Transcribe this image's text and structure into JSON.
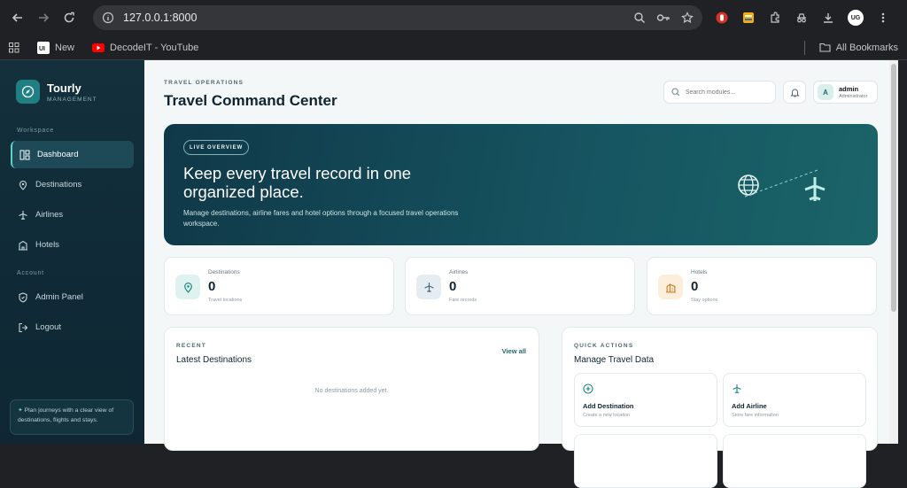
{
  "browser": {
    "url": "127.0.0.1:8000",
    "profile_initials": "UG",
    "bookmarks": [
      {
        "label": "New"
      },
      {
        "label": "DecodeIT - YouTube"
      }
    ],
    "all_bookmarks": "All Bookmarks"
  },
  "sidebar": {
    "brand_name": "Tourly",
    "brand_sub": "MANAGEMENT",
    "workspace_label": "Workspace",
    "account_label": "Account",
    "items": [
      {
        "label": "Dashboard"
      },
      {
        "label": "Destinations"
      },
      {
        "label": "Airlines"
      },
      {
        "label": "Hotels"
      }
    ],
    "account_items": [
      {
        "label": "Admin Panel"
      },
      {
        "label": "Logout"
      }
    ],
    "note": "Plan journeys with a clear view of destinations, flights and stays."
  },
  "header": {
    "eyebrow": "TRAVEL OPERATIONS",
    "title": "Travel Command Center",
    "search_placeholder": "Search modules...",
    "user_initial": "A",
    "user_name": "admin",
    "user_role": "Administrator"
  },
  "hero": {
    "badge": "LIVE OVERVIEW",
    "title": "Keep every travel record in one organized place.",
    "description": "Manage destinations, airline fares and hotel options through a focused travel operations workspace."
  },
  "stats": [
    {
      "label": "Destinations",
      "value": "0",
      "sub": "Travel locations",
      "color": "#1f8a7e"
    },
    {
      "label": "Airlines",
      "value": "0",
      "sub": "Fare records",
      "color": "#4a6b86"
    },
    {
      "label": "Hotels",
      "value": "0",
      "sub": "Stay options",
      "color": "#c9822d"
    }
  ],
  "recent": {
    "eyebrow": "RECENT",
    "title": "Latest Destinations",
    "view_all": "View all",
    "empty": "No destinations added yet."
  },
  "quick_actions": {
    "eyebrow": "QUICK ACTIONS",
    "title": "Manage Travel Data",
    "items": [
      {
        "title": "Add Destination",
        "sub": "Create a new location"
      },
      {
        "title": "Add Airline",
        "sub": "Store fare information"
      }
    ]
  },
  "colors": {
    "accent": "#1b6a6c",
    "sidebar_bg": "#14303d",
    "hero_bg": "#165561"
  }
}
